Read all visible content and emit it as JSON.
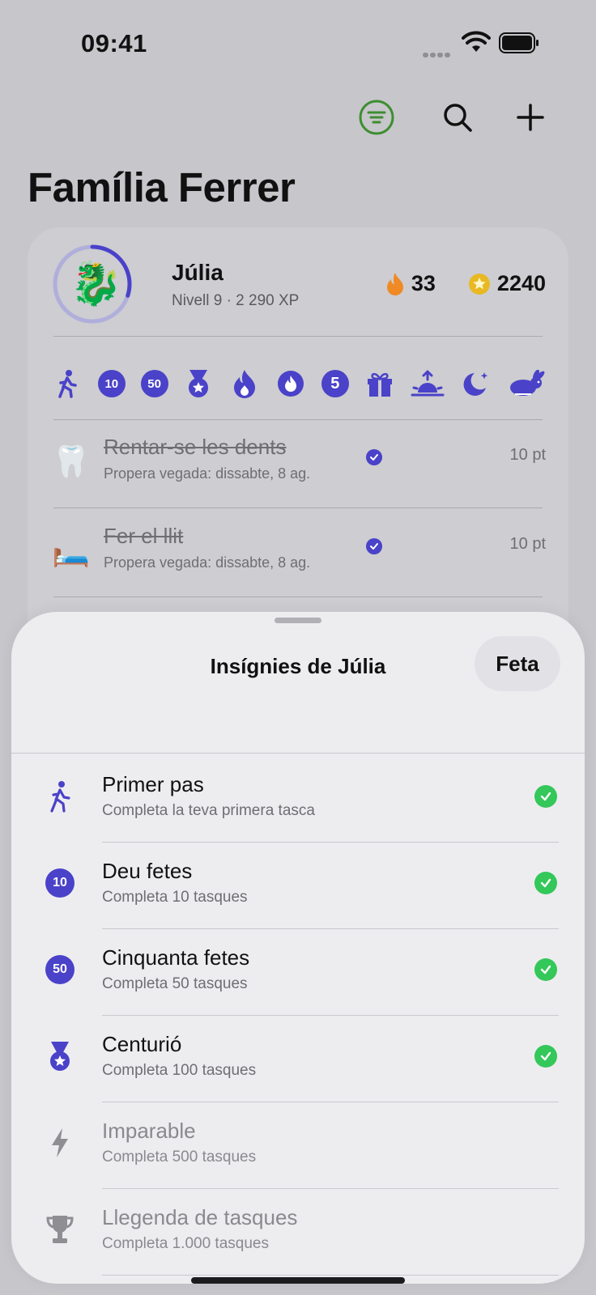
{
  "status_bar": {
    "time": "09:41"
  },
  "family": {
    "title": "Família Ferrer"
  },
  "profile": {
    "name": "Júlia",
    "level": "Nivell 9 · 2 290 XP",
    "level_progress": 0.3,
    "avatar_emoji": "🐉",
    "streak": "33",
    "points": "2240"
  },
  "tasks": [
    {
      "emoji": "🦷",
      "title": "Rentar-se les dents",
      "subtitle": "Propera vegada: dissabte, 8 ag.",
      "points": "10 pt"
    },
    {
      "emoji": "🛏️",
      "title": "Fer el llit",
      "subtitle": "Propera vegada: dissabte, 8 ag.",
      "points": "10 pt"
    }
  ],
  "sheet": {
    "title": "Insígnies de Júlia",
    "done_label": "Feta",
    "badges": [
      {
        "title": "Primer pas",
        "subtitle": "Completa la teva primera tasca",
        "icon": "walk-icon",
        "earned": true
      },
      {
        "title": "Deu fetes",
        "subtitle": "Completa 10 tasques",
        "icon": "10",
        "earned": true
      },
      {
        "title": "Cinquanta fetes",
        "subtitle": "Completa 50 tasques",
        "icon": "50",
        "earned": true
      },
      {
        "title": "Centurió",
        "subtitle": "Completa 100 tasques",
        "icon": "medal-icon",
        "earned": true
      },
      {
        "title": "Imparable",
        "subtitle": "Completa 500 tasques",
        "icon": "bolt-icon",
        "earned": false
      },
      {
        "title": "Llegenda de tasques",
        "subtitle": "Completa 1.000 tasques",
        "icon": "trophy-icon",
        "earned": false
      }
    ]
  },
  "colors": {
    "accent": "#4a42c8",
    "success": "#34c759",
    "flame": "#f08a24",
    "star": "#e8b923",
    "filter": "#3e8e2f"
  }
}
